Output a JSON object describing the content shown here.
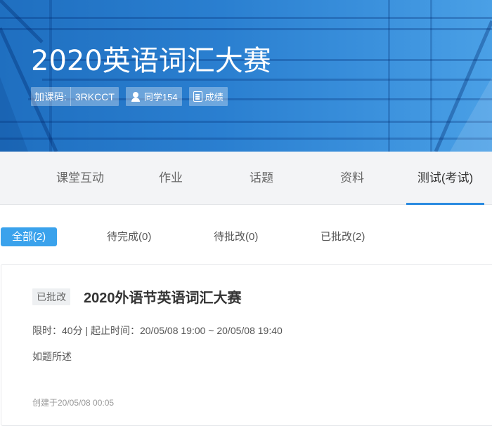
{
  "course": {
    "title": "2020英语词汇大赛",
    "join_code_label": "加课码:",
    "join_code": "3RKCCT",
    "students_label": "同学154",
    "grades_label": "成绩"
  },
  "tabs": [
    {
      "label": "课堂互动"
    },
    {
      "label": "作业"
    },
    {
      "label": "话题"
    },
    {
      "label": "资料"
    },
    {
      "label": "测试(考试)"
    }
  ],
  "active_tab": "测试(考试)",
  "filters": [
    {
      "label": "全部(2)"
    },
    {
      "label": "待完成(0)"
    },
    {
      "label": "待批改(0)"
    },
    {
      "label": "已批改(2)"
    }
  ],
  "exam": {
    "status": "已批改",
    "title": "2020外语节英语词汇大赛",
    "time_info": "限时：40分 | 起止时间：20/05/08 19:00 ~ 20/05/08 19:40",
    "description": "如题所述",
    "created": "创建于20/05/08 00:05"
  },
  "colors": {
    "banner": "#2a7fd0",
    "accent": "#3aa2ec",
    "tab_indicator": "#2b8be0"
  }
}
